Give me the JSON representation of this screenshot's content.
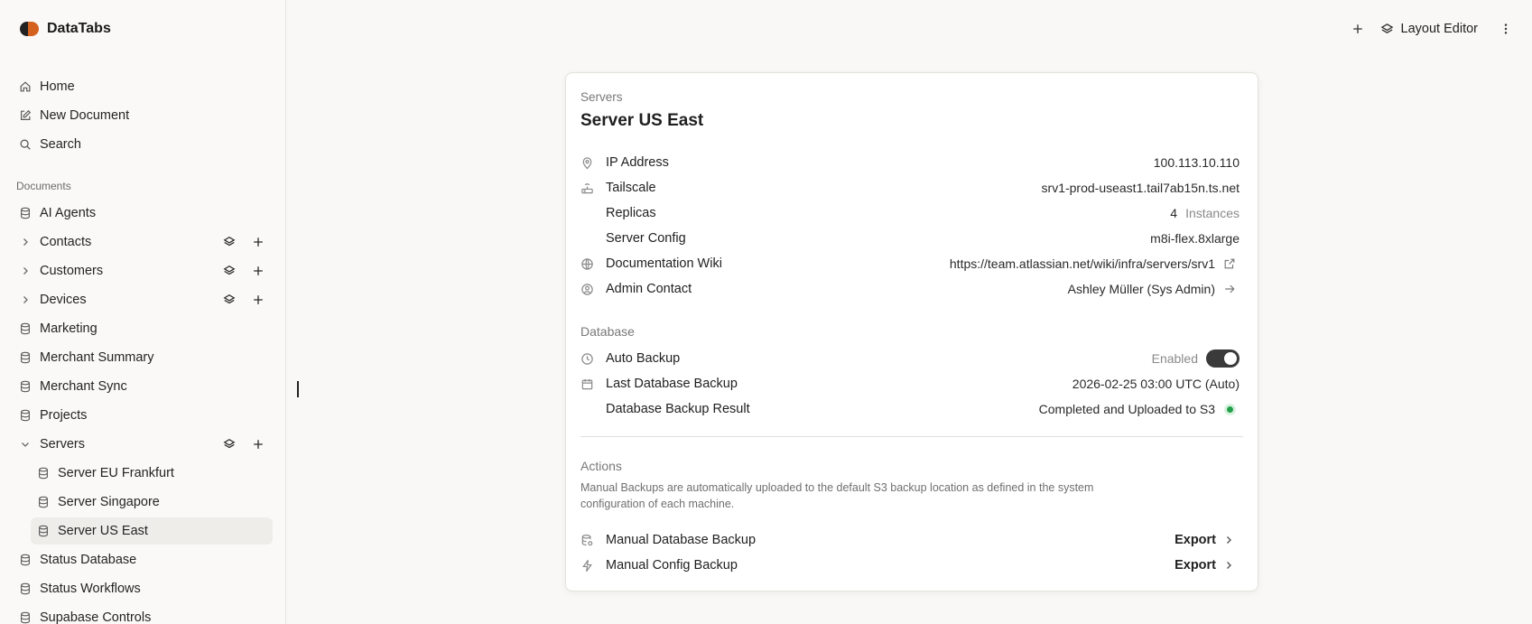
{
  "app": {
    "name": "DataTabs"
  },
  "sidebar": {
    "top_items": [
      {
        "label": "Home",
        "icon": "home-icon"
      },
      {
        "label": "New Document",
        "icon": "edit-icon"
      },
      {
        "label": "Search",
        "icon": "search-icon"
      }
    ],
    "section_label": "Documents",
    "docs": [
      {
        "label": "AI Agents"
      },
      {
        "label": "Contacts"
      },
      {
        "label": "Customers"
      },
      {
        "label": "Devices"
      },
      {
        "label": "Marketing"
      },
      {
        "label": "Merchant Summary"
      },
      {
        "label": "Merchant Sync"
      },
      {
        "label": "Projects"
      },
      {
        "label": "Servers"
      },
      {
        "label": "Server EU Frankfurt"
      },
      {
        "label": "Server Singapore"
      },
      {
        "label": "Server US East"
      },
      {
        "label": "Status Database"
      },
      {
        "label": "Status Workflows"
      },
      {
        "label": "Supabase Controls"
      }
    ]
  },
  "topbar": {
    "layout_editor_label": "Layout Editor"
  },
  "card": {
    "breadcrumb": "Servers",
    "title": "Server US East",
    "details": [
      {
        "label": "IP Address",
        "value": "100.113.10.110",
        "icon": "location-pin-icon"
      },
      {
        "label": "Tailscale",
        "value": "srv1-prod-useast1.tail7ab15n.ts.net",
        "icon": "router-icon"
      },
      {
        "label": "Replicas",
        "value": "4",
        "unit": "Instances"
      },
      {
        "label": "Server Config",
        "value": "m8i-flex.8xlarge"
      },
      {
        "label": "Documentation Wiki",
        "value": "https://team.atlassian.net/wiki/infra/servers/srv1",
        "icon": "globe-icon"
      },
      {
        "label": "Admin Contact",
        "value": "Ashley Müller (Sys Admin)",
        "icon": "user-circle-icon"
      }
    ],
    "database_heading": "Database",
    "database": [
      {
        "label": "Auto Backup",
        "value": "Enabled",
        "icon": "clock-icon",
        "toggle_on": true
      },
      {
        "label": "Last Database Backup",
        "value": "2026-02-25 03:00 UTC (Auto)",
        "icon": "calendar-icon"
      },
      {
        "label": "Database Backup Result",
        "value": "Completed and Uploaded to S3",
        "status_color": "#22a04a"
      }
    ],
    "actions_heading": "Actions",
    "actions_description": "Manual Backups are automatically uploaded to the default S3 backup location as defined in the system configuration of each machine.",
    "actions": [
      {
        "label": "Manual Database Backup",
        "button": "Export",
        "icon": "database-settings-icon"
      },
      {
        "label": "Manual Config Backup",
        "button": "Export",
        "icon": "bolt-icon"
      }
    ]
  }
}
